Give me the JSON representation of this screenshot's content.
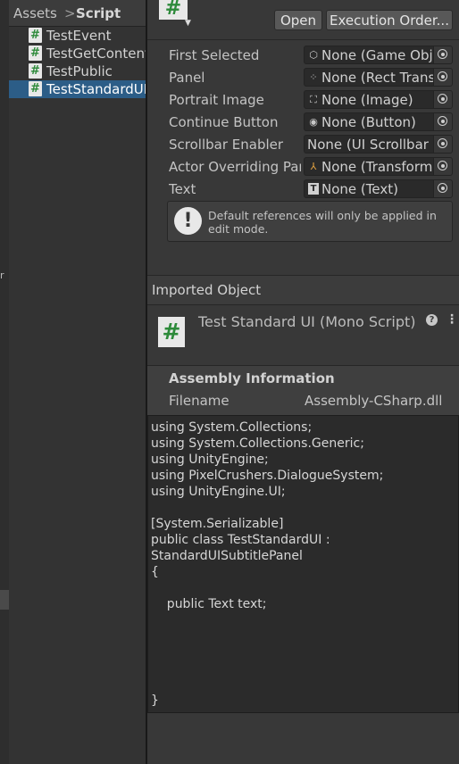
{
  "project": {
    "breadcrumb": {
      "root": "Assets",
      "separator": ">",
      "current": "Script"
    },
    "files": [
      {
        "label": "TestEvent",
        "selected": false
      },
      {
        "label": "TestGetContent",
        "selected": false
      },
      {
        "label": "TestPublic",
        "selected": false
      },
      {
        "label": "TestStandardUI",
        "selected": true
      }
    ],
    "gutter_glyph": "r"
  },
  "inspector": {
    "header": {
      "open_label": "Open",
      "execution_order_label": "Execution Order..."
    },
    "properties": [
      {
        "label": "First Selected",
        "icon": "cube-icon",
        "value": "None (Game Object)"
      },
      {
        "label": "Panel",
        "icon": "rect-transform-icon",
        "value": "None (Rect Transform)"
      },
      {
        "label": "Portrait Image",
        "icon": "image-icon",
        "value": "None (Image)"
      },
      {
        "label": "Continue Button",
        "icon": "button-icon",
        "value": "None (Button)"
      },
      {
        "label": "Scrollbar Enabler",
        "icon": "",
        "value": "None (UI Scrollbar Enabler)"
      },
      {
        "label": "Actor Overriding Panel",
        "icon": "transform-icon",
        "value": "None (Transform)"
      },
      {
        "label": "Text",
        "icon": "text-icon",
        "value": "None (Text)"
      }
    ],
    "help_box": {
      "text": "Default references will only be applied in edit mode."
    },
    "imported": {
      "label": "Imported Object",
      "title": "Test Standard UI (Mono Script)"
    },
    "assembly": {
      "title": "Assembly Information",
      "filename_label": "Filename",
      "filename_value": "Assembly-CSharp.dll"
    },
    "code": "using System.Collections;\nusing System.Collections.Generic;\nusing UnityEngine;\nusing PixelCrushers.DialogueSystem;\nusing UnityEngine.UI;\n\n[System.Serializable]\npublic class TestStandardUI :\nStandardUISubtitlePanel\n{\n\n    public Text text;\n\n\n\n\n\n}"
  }
}
